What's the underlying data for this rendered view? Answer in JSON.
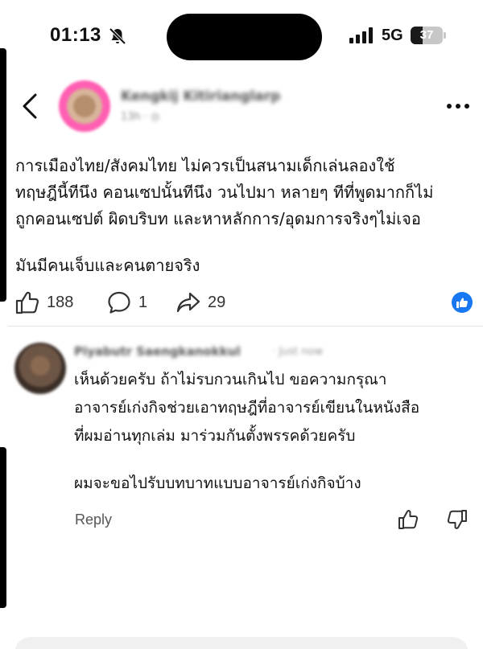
{
  "status_bar": {
    "time": "01:13",
    "network": "5G",
    "battery_level": "37",
    "battery_fraction": 0.37
  },
  "post": {
    "author_name": "Kengkij Kitirianglarp",
    "meta": "13h · ◎",
    "text": "การเมืองไทย/สังคมไทย ไม่ควรเป็นสนามเด็กเล่นลองใช้\nทฤษฎีนี้ทีนึง คอนเซปนั้นทีนึง วนไปมา หลายๆ ทีที่พูดมากก็ไม่\nถูกคอนเซปต์ ผิดบริบท และหาหลักการ/อุดมการจริงๆไม่เจอ",
    "text2": "มันมีคนเจ็บและคนตายจริง",
    "likes": "188",
    "comments": "1",
    "shares": "29"
  },
  "comment": {
    "author_name": "Piyabutr Saengkanokkul",
    "time": "· Just now",
    "lines": [
      "เห็นด้วยครับ ถ้าไม่รบกวนเกินไป ขอความกรุณา",
      "อาจารย์เก่งกิจช่วยเอาทฤษฎีที่อาจารย์เขียนในหนังสือ",
      "ที่ผมอ่านทุกเล่ม มาร่วมกันตั้งพรรคด้วยครับ"
    ],
    "line2": "ผมจะขอไปรับบทบาทแบบอาจารย์เก่งกิจบ้าง",
    "reply_label": "Reply"
  },
  "colors": {
    "accent": "#1877f2",
    "avatar_ring": "#ff5fb2"
  },
  "icons": [
    "bell-off-icon",
    "signal-icon",
    "back-icon",
    "more-icon",
    "thumbs-up-icon",
    "comment-icon",
    "share-icon",
    "thumbs-down-icon"
  ]
}
